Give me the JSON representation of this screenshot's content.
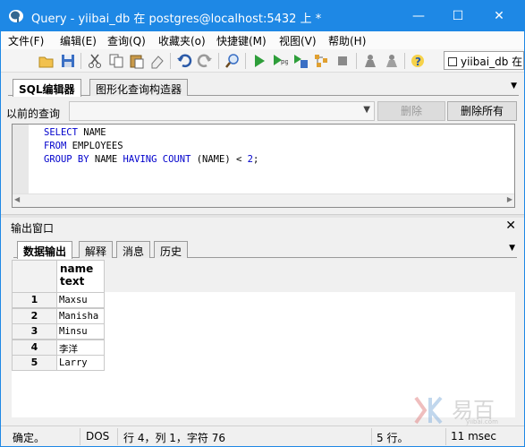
{
  "window": {
    "title": "Query - yiibai_db 在 postgres@localhost:5432 上 *",
    "minimize": "—",
    "maximize": "☐",
    "close": "✕"
  },
  "menu": [
    "文件(F)",
    "编辑(E)",
    "查询(Q)",
    "收藏夹(o)",
    "快捷键(M)",
    "视图(V)",
    "帮助(H)"
  ],
  "toolbar": {
    "icons": [
      "open-file-icon",
      "save-icon",
      "cut-icon",
      "copy-icon",
      "paste-icon",
      "clear-icon",
      "undo-icon",
      "redo-icon",
      "find-icon",
      "execute-icon",
      "execute-pgscript-icon",
      "execute-to-file-icon",
      "explain-icon",
      "stop-icon",
      "commit-icon",
      "rollback-icon",
      "help-icon"
    ],
    "db_label": "yiibai_db 在"
  },
  "query_tabs": [
    "SQL编辑器",
    "图形化查询构造器"
  ],
  "history": {
    "label": "以前的查询",
    "delete": "删除",
    "delete_all": "删除所有"
  },
  "editor": {
    "lines": [
      [
        {
          "t": "SELECT",
          "k": 1
        },
        {
          "t": " NAME",
          "k": 0
        }
      ],
      [
        {
          "t": "FROM",
          "k": 1
        },
        {
          "t": " EMPLOYEES",
          "k": 0
        }
      ],
      [
        {
          "t": "GROUP BY",
          "k": 1
        },
        {
          "t": " NAME ",
          "k": 0
        },
        {
          "t": "HAVING",
          "k": 1
        },
        {
          "t": " ",
          "k": 0
        },
        {
          "t": "COUNT",
          "k": 1
        },
        {
          "t": " (NAME) < ",
          "k": 0
        },
        {
          "t": "2",
          "k": 2
        },
        {
          "t": ";",
          "k": 0
        }
      ]
    ]
  },
  "output": {
    "title": "输出窗口",
    "close": "✕",
    "tabs": [
      "数据输出",
      "解释",
      "消息",
      "历史"
    ],
    "column": {
      "name": "name",
      "type": "text"
    },
    "rows": [
      {
        "n": "1",
        "v": "Maxsu"
      },
      {
        "n": "2",
        "v": "Manisha"
      },
      {
        "n": "3",
        "v": "Minsu"
      },
      {
        "n": "4",
        "v": "李洋"
      },
      {
        "n": "5",
        "v": "Larry"
      }
    ]
  },
  "status": {
    "ready": "确定。",
    "encoding": "DOS",
    "position": "行 4，列 1，字符 76",
    "rows": "5 行。",
    "time": "11 msec"
  },
  "watermark": {
    "text": "易百",
    "sub": "yiibai.com"
  },
  "colors": {
    "titlebar": "#1e88e5",
    "keyword": "#0000cc"
  }
}
